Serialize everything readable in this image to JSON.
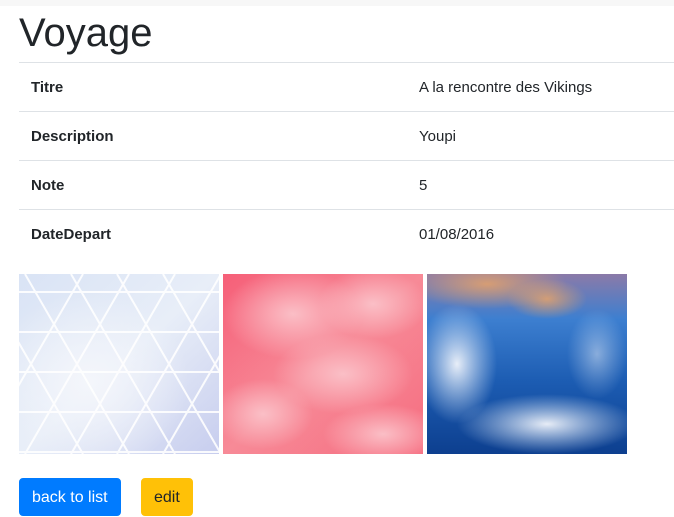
{
  "page": {
    "title": "Voyage"
  },
  "details": [
    {
      "label": "Titre",
      "value": "A la rencontre des Vikings"
    },
    {
      "label": "Description",
      "value": "Youpi"
    },
    {
      "label": "Note",
      "value": "5"
    },
    {
      "label": "DateDepart",
      "value": "01/08/2016"
    }
  ],
  "gallery": {
    "images": [
      {
        "name": "geometric-triangle-pattern-image",
        "accent": "#c9d6ee"
      },
      {
        "name": "pink-clouds-image",
        "accent": "#f7808f"
      },
      {
        "name": "blue-abstract-swirl-image",
        "accent": "#1f6fc2"
      }
    ]
  },
  "actions": {
    "back_label": "back to list",
    "edit_label": "edit"
  },
  "colors": {
    "primary": "#007bff",
    "warning": "#ffc107",
    "border": "#dee2e6"
  }
}
